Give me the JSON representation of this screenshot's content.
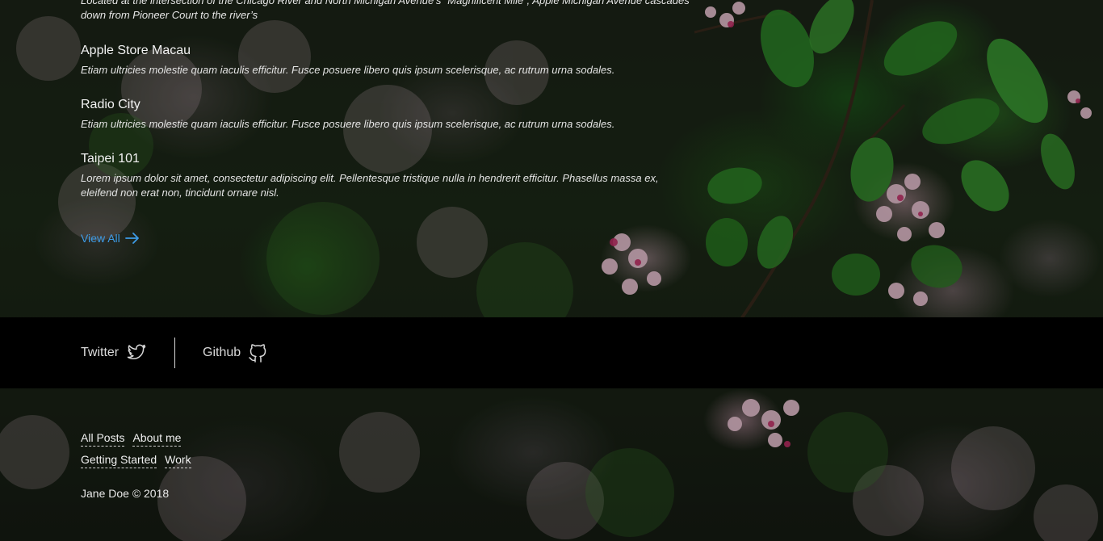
{
  "posts_section": {
    "lead_description": "Located at the intersection of the Chicago River and North Michigan Avenue’s “Magnificent Mile”, Apple Michigan Avenue cascades down from Pioneer Court to the river’s",
    "posts": [
      {
        "title": "Apple Store Macau",
        "description": "Etiam ultricies molestie quam iaculis efficitur. Fusce posuere libero quis ipsum scelerisque, ac rutrum urna sodales."
      },
      {
        "title": "Radio City",
        "description": "Etiam ultricies molestie quam iaculis efficitur. Fusce posuere libero quis ipsum scelerisque, ac rutrum urna sodales."
      },
      {
        "title": "Taipei 101",
        "description": "Lorem ipsum dolor sit amet, consectetur adipiscing elit. Pellentesque tristique nulla in hendrerit efficitur. Phasellus massa ex, eleifend non erat non, tincidunt ornare nisl."
      }
    ],
    "view_all_label": "View All",
    "view_all_icon": "arrow-right-icon",
    "link_color": "#3d9be6"
  },
  "social": {
    "twitter_label": "Twitter",
    "twitter_icon": "twitter-icon",
    "github_label": "Github",
    "github_icon": "github-icon"
  },
  "footer": {
    "links_row1": [
      "All Posts",
      "About me"
    ],
    "links_row2": [
      "Getting Started",
      "Work"
    ],
    "copyright": "Jane Doe © 2018"
  }
}
